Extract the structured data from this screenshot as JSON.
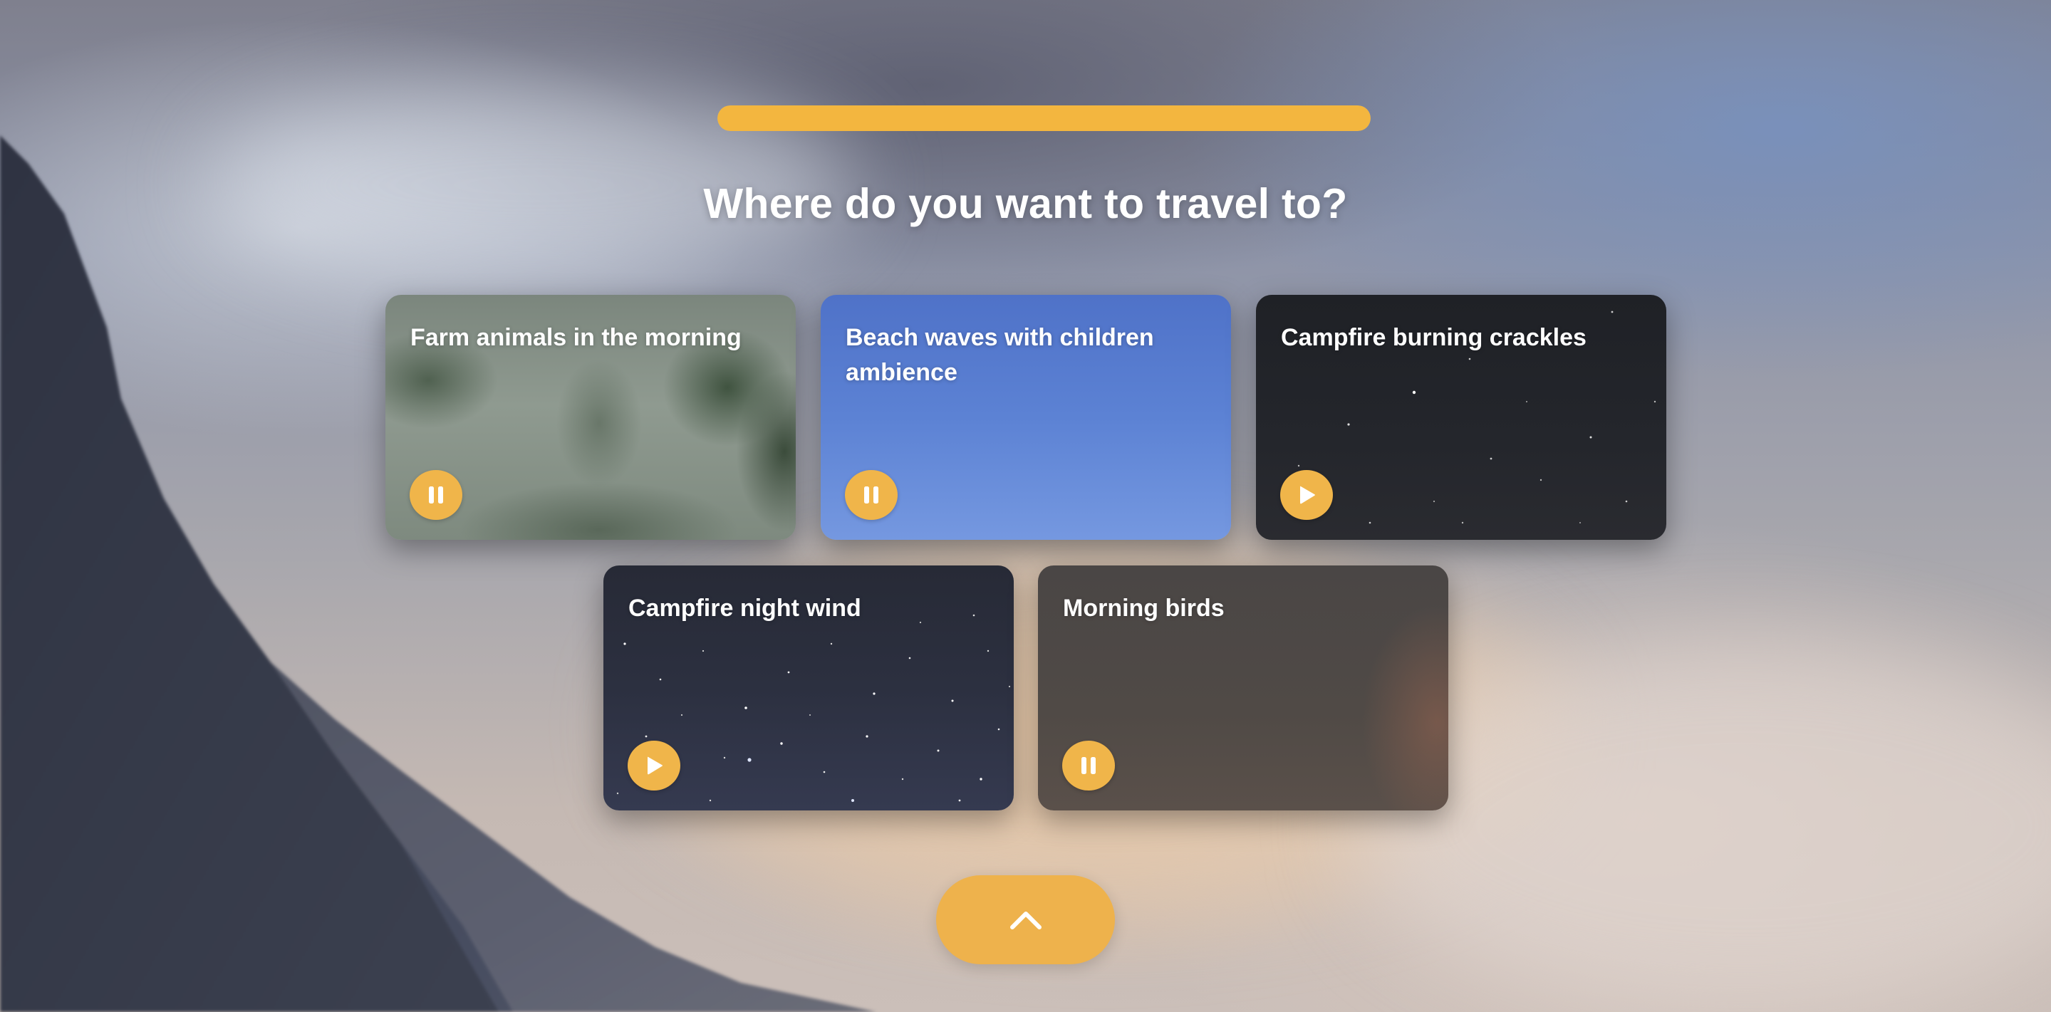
{
  "page": {
    "title": "Where do you want to travel to?"
  },
  "progress": {
    "fraction": 1.0,
    "color": "#f3b63f"
  },
  "cards": [
    {
      "title": "Farm animals in the morning",
      "state": "playing",
      "button_icon": "pause-icon"
    },
    {
      "title": "Beach waves with children ambience",
      "state": "playing",
      "button_icon": "pause-icon"
    },
    {
      "title": "Campfire burning crackles",
      "state": "paused",
      "button_icon": "play-icon"
    },
    {
      "title": "Campfire night wind",
      "state": "paused",
      "button_icon": "play-icon"
    },
    {
      "title": "Morning birds",
      "state": "playing",
      "button_icon": "pause-icon"
    }
  ],
  "scroll_button": {
    "icon": "chevron-up-icon"
  },
  "colors": {
    "accent": "#f0b54a",
    "text": "#ffffff"
  }
}
